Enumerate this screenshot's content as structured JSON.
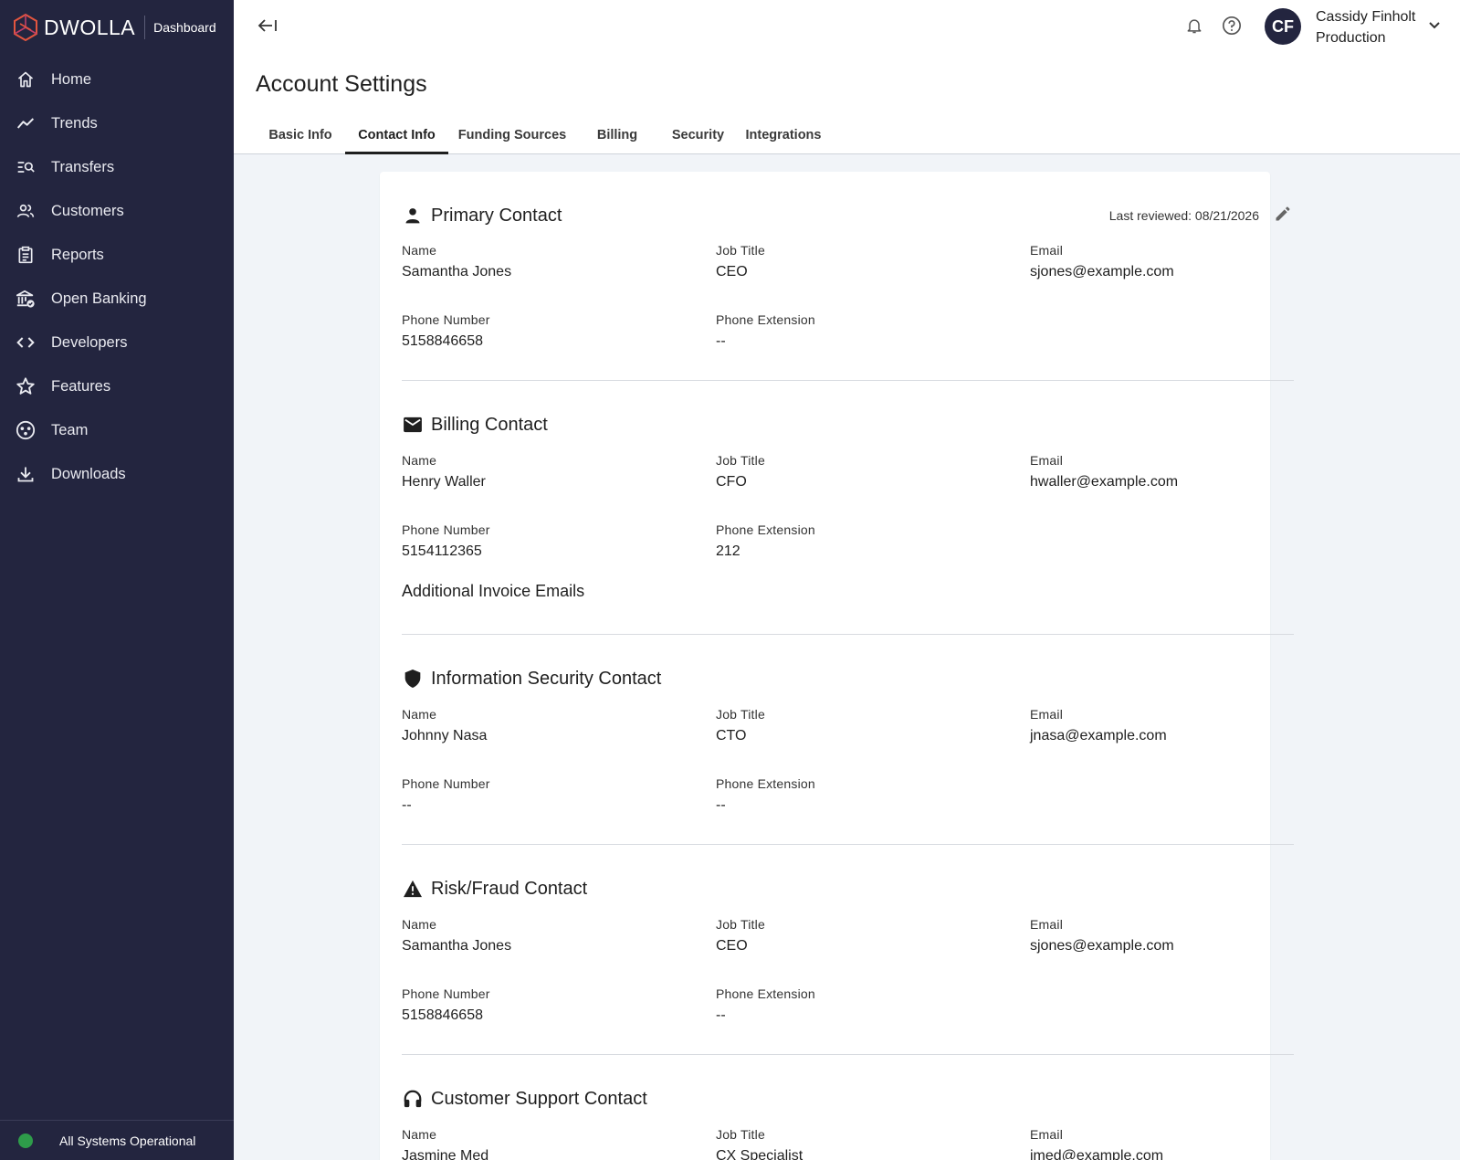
{
  "brand": {
    "name": "DWOLLA",
    "sub": "Dashboard"
  },
  "sidebar": {
    "items": [
      {
        "label": "Home",
        "icon": "home-icon"
      },
      {
        "label": "Trends",
        "icon": "trend-line-icon"
      },
      {
        "label": "Transfers",
        "icon": "transfer-search-icon"
      },
      {
        "label": "Customers",
        "icon": "people-icon"
      },
      {
        "label": "Reports",
        "icon": "clipboard-icon"
      },
      {
        "label": "Open Banking",
        "icon": "bank-check-icon"
      },
      {
        "label": "Developers",
        "icon": "code-icon"
      },
      {
        "label": "Features",
        "icon": "star-icon"
      },
      {
        "label": "Team",
        "icon": "team-icon"
      },
      {
        "label": "Downloads",
        "icon": "download-icon"
      }
    ],
    "status": "All Systems Operational"
  },
  "header": {
    "user_initials": "CF",
    "user_name": "Cassidy Finholt",
    "environment": "Production",
    "page_title": "Account Settings"
  },
  "tabs": [
    {
      "label": "Basic Info"
    },
    {
      "label": "Contact Info",
      "active": true
    },
    {
      "label": "Funding Sources"
    },
    {
      "label": "Billing"
    },
    {
      "label": "Security"
    },
    {
      "label": "Integrations"
    }
  ],
  "labels": {
    "name": "Name",
    "job_title": "Job Title",
    "email": "Email",
    "phone": "Phone Number",
    "extension": "Phone Extension"
  },
  "last_reviewed": "Last reviewed: 08/21/2026",
  "sections": {
    "primary": {
      "title": "Primary Contact",
      "name": "Samantha Jones",
      "job_title": "CEO",
      "email": "sjones@example.com",
      "phone": "5158846658",
      "extension": "--"
    },
    "billing": {
      "title": "Billing Contact",
      "name": "Henry Waller",
      "job_title": "CFO",
      "email": "hwaller@example.com",
      "phone": "5154112365",
      "extension": "212",
      "additional": "Additional Invoice Emails"
    },
    "security": {
      "title": "Information Security Contact",
      "name": "Johnny Nasa",
      "job_title": "CTO",
      "email": "jnasa@example.com",
      "phone": "--",
      "extension": "--"
    },
    "risk": {
      "title": "Risk/Fraud Contact",
      "name": "Samantha Jones",
      "job_title": "CEO",
      "email": "sjones@example.com",
      "phone": "5158846658",
      "extension": "--"
    },
    "support": {
      "title": "Customer Support Contact",
      "name": "Jasmine Med",
      "job_title": "CX Specialist",
      "email": "jmed@example.com"
    }
  },
  "colors": {
    "sidebar": "#23253f",
    "status_ok": "#2e9c4a",
    "brand_accent": "#e2553f"
  }
}
